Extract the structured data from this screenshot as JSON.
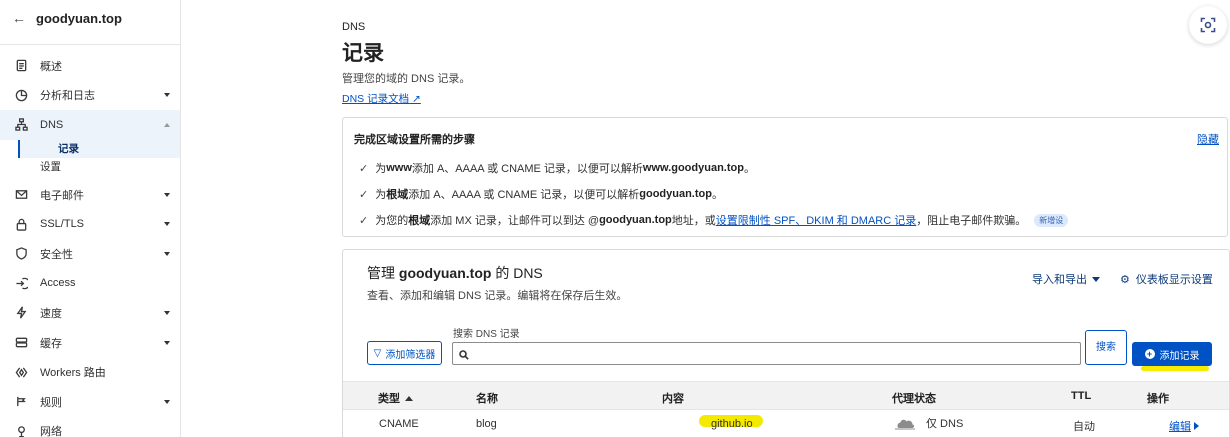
{
  "sidebar": {
    "title": "goodyuan.top",
    "items": [
      {
        "label": "概述",
        "icon": "document-icon"
      },
      {
        "label": "分析和日志",
        "icon": "chart-icon",
        "expandable": true
      },
      {
        "label": "DNS",
        "icon": "network-icon",
        "expanded": true
      },
      {
        "label": "电子邮件",
        "icon": "email-icon",
        "expandable": true
      },
      {
        "label": "SSL/TLS",
        "icon": "lock-icon",
        "expandable": true
      },
      {
        "label": "安全性",
        "icon": "shield-icon",
        "expandable": true
      },
      {
        "label": "Access",
        "icon": "access-icon"
      },
      {
        "label": "速度",
        "icon": "bolt-icon",
        "expandable": true
      },
      {
        "label": "缓存",
        "icon": "cache-icon",
        "expandable": true
      },
      {
        "label": "Workers 路由",
        "icon": "workers-icon"
      },
      {
        "label": "规则",
        "icon": "rules-icon",
        "expandable": true
      },
      {
        "label": "网络",
        "icon": "pin-icon"
      }
    ],
    "dns_sub": [
      "记录",
      "设置"
    ]
  },
  "header": {
    "crumb": "DNS",
    "title": "记录",
    "description": "管理您的域的 DNS 记录。",
    "doc_link": "DNS 记录文档"
  },
  "steps": {
    "title": "完成区域设置所需的步骤",
    "hide_label": "隐藏",
    "step1": {
      "p1": "为 ",
      "b1": "www",
      "p2": " 添加 A、AAAA 或 CNAME 记录，以便可以解析 ",
      "b2": "www.goodyuan.top",
      "p3": "。"
    },
    "step2": {
      "p1": "为",
      "b1": "根域",
      "p2": "添加 A、AAAA 或 CNAME 记录，以便可以解析 ",
      "b2": "goodyuan.top",
      "p3": "。"
    },
    "step3": {
      "p1": "为您的",
      "b1": "根域",
      "p2": "添加 MX 记录，让邮件可以到达 @",
      "b2": "goodyuan.top",
      "p3": " 地址，或",
      "link": "设置限制性 SPF、DKIM 和 DMARC 记录",
      "p4": "，阻止电子邮件欺骗。",
      "badge": "新增设"
    }
  },
  "manage": {
    "title_prefix": "管理 ",
    "title_domain": "goodyuan.top",
    "title_suffix": " 的 DNS",
    "description": "查看、添加和编辑 DNS 记录。编辑将在保存后生效。",
    "import_export": "导入和导出",
    "dashboard_settings": "仪表板显示设置",
    "search_label": "搜索 DNS 记录",
    "search_value": "",
    "filter_button": "添加筛选器",
    "search_button": "搜索",
    "add_button": "添加记录"
  },
  "table": {
    "headers": {
      "type": "类型",
      "name": "名称",
      "content": "内容",
      "proxy": "代理状态",
      "ttl": "TTL",
      "actions": "操作"
    },
    "rows": [
      {
        "type": "CNAME",
        "name": "blog",
        "content": "github.io",
        "proxy": "仅 DNS",
        "ttl": "自动",
        "action": "编辑"
      }
    ]
  },
  "colors": {
    "accent": "#0051c3",
    "highlight": "#f7ec00"
  }
}
